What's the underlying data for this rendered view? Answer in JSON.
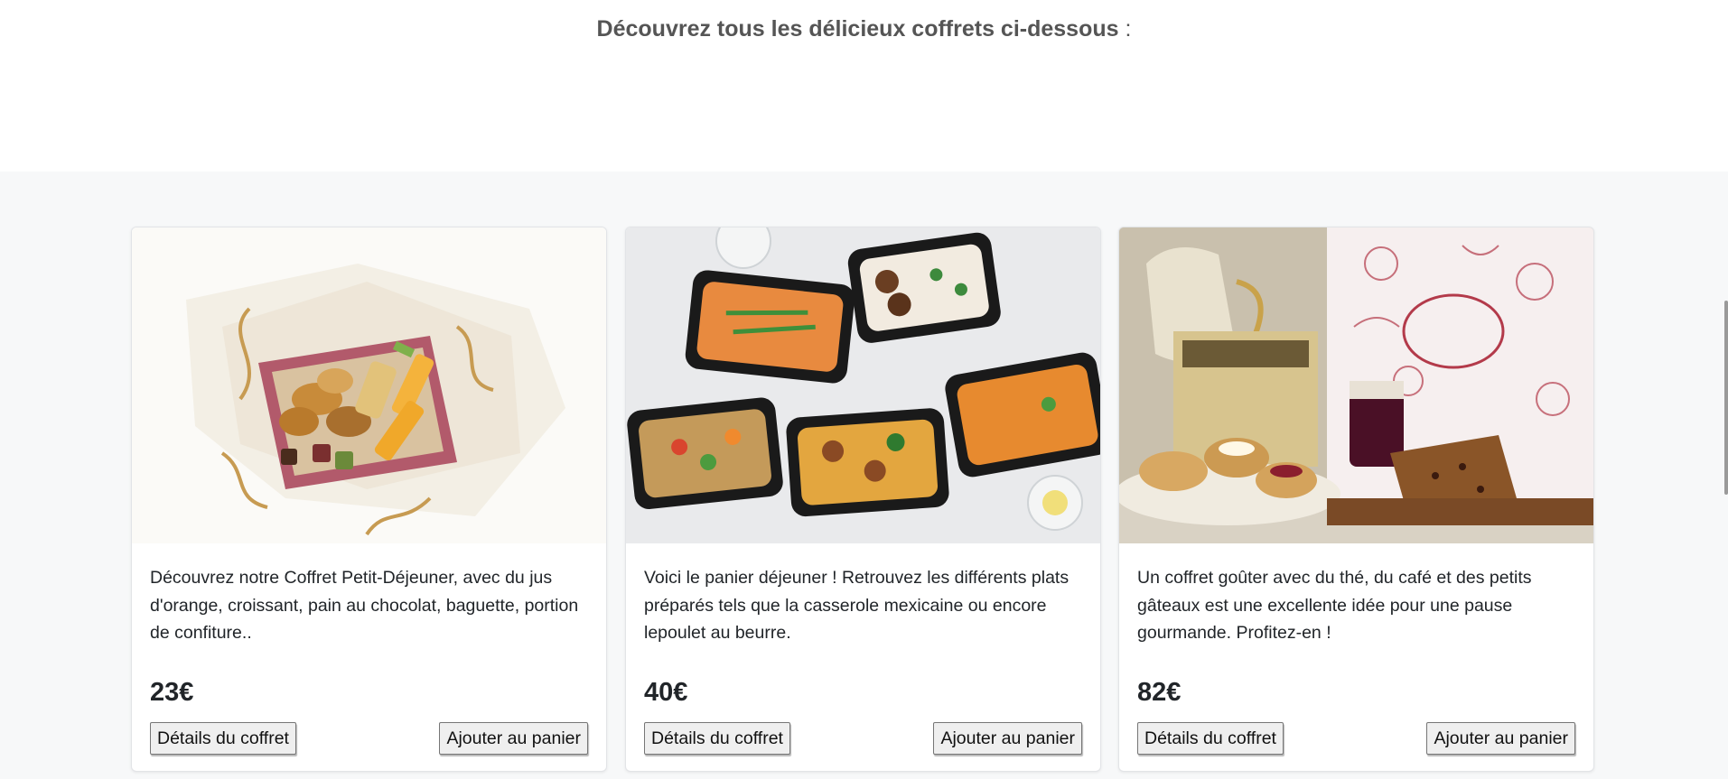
{
  "intro": {
    "title": "Découvrez tous les délicieux coffrets ci-dessous",
    "suffix": " :"
  },
  "products": [
    {
      "image_alt": "Coffret Petit-Déjeuner",
      "description": "Découvrez notre Coffret Petit-Déjeuner, avec du jus d'orange, croissant, pain au chocolat, baguette, portion de confiture..",
      "price": "23€",
      "details_label": "Détails du coffret",
      "add_label": "Ajouter au panier"
    },
    {
      "image_alt": "Panier déjeuner",
      "description": "Voici le panier déjeuner ! Retrouvez les différents plats préparés tels que la casserole mexicaine ou encore lepoulet au beurre.",
      "price": "40€",
      "details_label": "Détails du coffret",
      "add_label": "Ajouter au panier"
    },
    {
      "image_alt": "Coffret goûter",
      "description": "Un coffret goûter avec du thé, du café et des petits gâteaux est une excellente idée pour une pause gourmande. Profitez-en !",
      "price": "82€",
      "details_label": "Détails du coffret",
      "add_label": "Ajouter au panier"
    }
  ],
  "colors": {
    "band_background": "#f7f8f9",
    "intro_text": "#555555",
    "card_border": "#e2e4e7"
  },
  "icons": {
    "image_1": "breakfast-basket-image",
    "image_2": "lunch-trays-image",
    "image_3": "afternoon-tea-image"
  }
}
